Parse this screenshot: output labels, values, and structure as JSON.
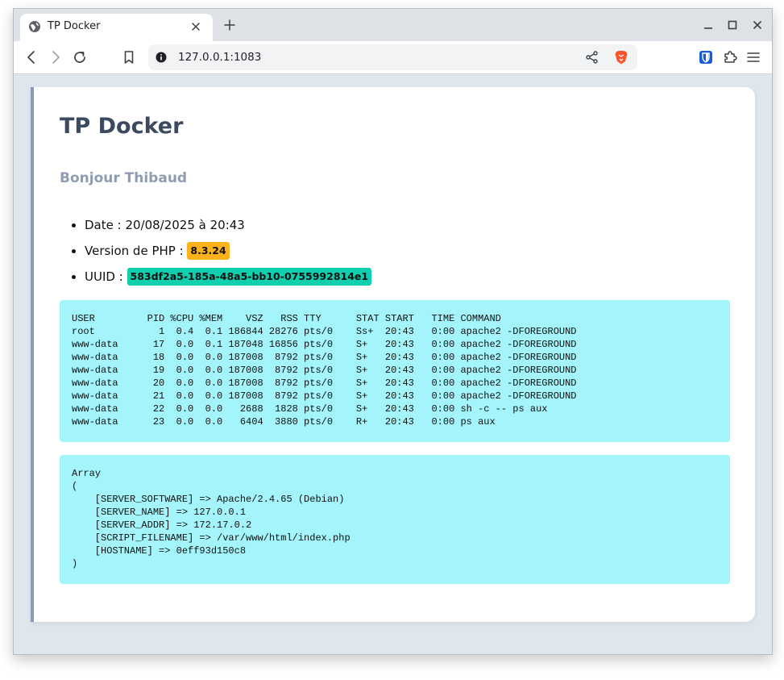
{
  "browser": {
    "tab_title": "TP Docker",
    "url": "127.0.0.1:1083",
    "icons": {
      "favicon": "globe-icon",
      "tab_close": "close-icon",
      "new_tab": "plus-icon",
      "back": "arrow-left-icon",
      "forward": "arrow-right-icon",
      "reload": "reload-icon",
      "bookmark": "bookmark-icon",
      "site_info": "info-icon",
      "share": "share-icon",
      "brave_shields": "brave-lion-icon",
      "bitwarden": "bitwarden-shield-icon",
      "extensions": "puzzle-icon",
      "menu": "hamburger-menu-icon",
      "minimize": "minimize-icon",
      "maximize": "maximize-icon",
      "close_window": "close-window-icon"
    },
    "colors": {
      "brave_orange": "#fb542b",
      "bitwarden_blue": "#175ddc"
    }
  },
  "page": {
    "title": "TP Docker",
    "greeting": "Bonjour Thibaud",
    "info": {
      "date_text": "Date : 20/08/2025 à 20:43",
      "php_label": "Version de PHP : ",
      "php_version": "8.3.24",
      "uuid_label": "UUID : ",
      "uuid": "583df2a5-185a-48a5-bb10-0755992814e1"
    },
    "ps_output": "USER         PID %CPU %MEM    VSZ   RSS TTY      STAT START   TIME COMMAND\nroot           1  0.4  0.1 186844 28276 pts/0    Ss+  20:43   0:00 apache2 -DFOREGROUND\nwww-data      17  0.0  0.1 187048 16856 pts/0    S+   20:43   0:00 apache2 -DFOREGROUND\nwww-data      18  0.0  0.0 187008  8792 pts/0    S+   20:43   0:00 apache2 -DFOREGROUND\nwww-data      19  0.0  0.0 187008  8792 pts/0    S+   20:43   0:00 apache2 -DFOREGROUND\nwww-data      20  0.0  0.0 187008  8792 pts/0    S+   20:43   0:00 apache2 -DFOREGROUND\nwww-data      21  0.0  0.0 187008  8792 pts/0    S+   20:43   0:00 apache2 -DFOREGROUND\nwww-data      22  0.0  0.0   2688  1828 pts/0    S+   20:43   0:00 sh -c -- ps aux\nwww-data      23  0.0  0.0   6404  3880 pts/0    R+   20:43   0:00 ps aux",
    "server_output": "Array\n(\n    [SERVER_SOFTWARE] => Apache/2.4.65 (Debian)\n    [SERVER_NAME] => 127.0.0.1\n    [SERVER_ADDR] => 172.17.0.2\n    [SCRIPT_FILENAME] => /var/www/html/index.php\n    [HOSTNAME] => 0eff93d150c8\n)",
    "colors": {
      "title": "#3c4a5f",
      "greeting": "#8e9db2",
      "php_badge": "#fbb21b",
      "uuid_badge": "#0fcfae",
      "pre_background": "#a4f4fb",
      "card_accent": "#8a9ab3"
    }
  }
}
